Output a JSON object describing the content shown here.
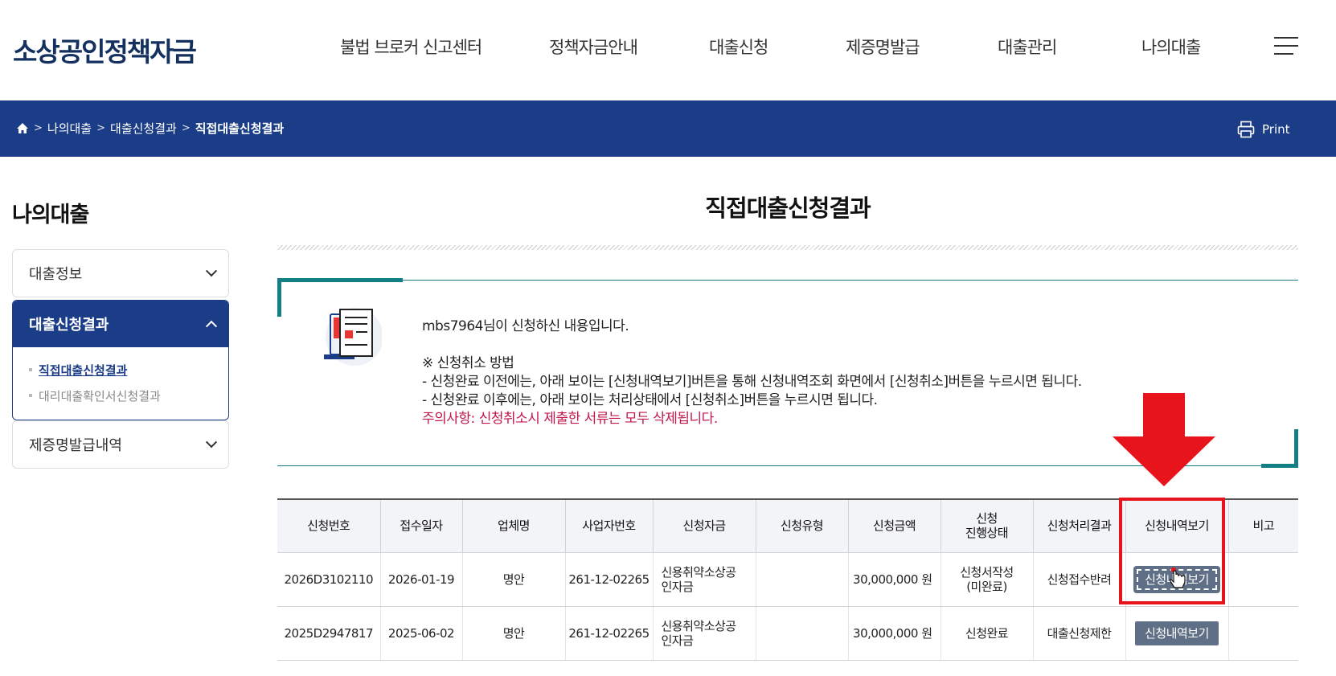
{
  "header": {
    "logo": "소상공인정책자금",
    "menu": [
      "불법 브로커 신고센터",
      "정책자금안내",
      "대출신청",
      "제증명발급",
      "대출관리",
      "나의대출"
    ]
  },
  "breadcrumb": {
    "items": [
      "나의대출",
      "대출신청결과",
      "직접대출신청결과"
    ],
    "print_label": "Print"
  },
  "sidebar": {
    "title": "나의대출",
    "groups": [
      {
        "label": "대출정보"
      },
      {
        "label": "대출신청결과",
        "items": [
          "직접대출신청결과",
          "대리대출확인서신청결과"
        ]
      },
      {
        "label": "제증명발급내역"
      }
    ]
  },
  "main": {
    "title": "직접대출신청결과",
    "notice": {
      "line1": "mbs7964님이 신청하신 내용입니다.",
      "line2": "※ 신청취소 방법",
      "line3": "- 신청완료 이전에는, 아래 보이는 [신청내역보기]버튼을 통해 신청내역조회 화면에서 [신청취소]버튼을 누르시면 됩니다.",
      "line4": "- 신청완료 이후에는, 아래 보이는 처리상태에서 [신청취소]버튼을 누르시면 됩니다.",
      "warning": "주의사항: 신청취소시 제출한 서류는 모두 삭제됩니다."
    },
    "table": {
      "headers": [
        "신청번호",
        "접수일자",
        "업체명",
        "사업자번호",
        "신청자금",
        "신청유형",
        "신청금액",
        "신청\n진행상태",
        "신청처리결과",
        "신청내역보기",
        "비고"
      ],
      "rows": [
        {
          "no": "2026D3102110",
          "date": "2026-01-19",
          "company": "명안",
          "bizno": "261-12-02265",
          "fund": "신용취약소상공\n인자금",
          "type": "",
          "amount": "30,000,000 원",
          "progress": "신청서작성\n(미완료)",
          "result": "신청접수반려",
          "button": "신청내역보기",
          "note": ""
        },
        {
          "no": "2025D2947817",
          "date": "2025-06-02",
          "company": "명안",
          "bizno": "261-12-02265",
          "fund": "신용취약소상공\n인자금",
          "type": "",
          "amount": "30,000,000 원",
          "progress": "신청완료",
          "result": "대출신청제한",
          "button": "신청내역보기",
          "note": ""
        }
      ]
    }
  }
}
